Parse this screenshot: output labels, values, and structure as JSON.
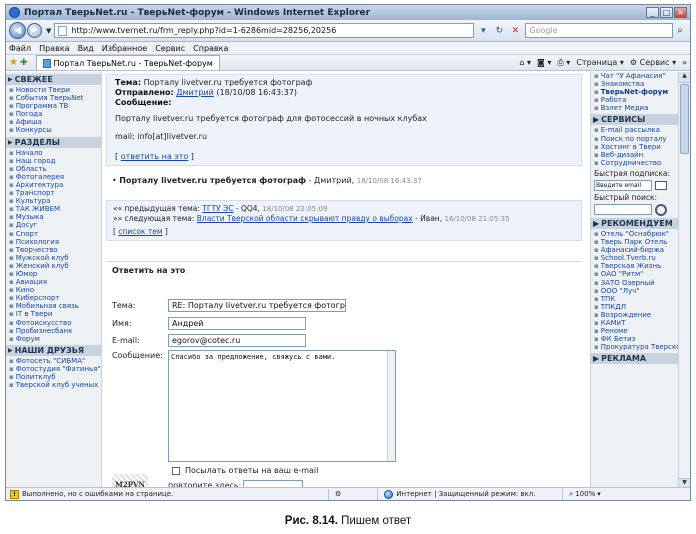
{
  "window": {
    "title": "Портал ТверьNet.ru - ТверьNet-форум - Windows Internet Explorer",
    "url": "http://www.tvernet.ru/frm_reply.php?id=1-6286mid=28256,20256",
    "search_placeholder": "Google"
  },
  "menu": [
    "Файл",
    "Правка",
    "Вид",
    "Избранное",
    "Сервис",
    "Справка"
  ],
  "tab": {
    "label": "Портал ТверьNet.ru - ТверьNet-форум"
  },
  "commands": {
    "page": "Страница",
    "tools": "Сервис"
  },
  "left": {
    "sections": [
      {
        "title": "СВЕЖЕЕ",
        "items": [
          "Новости Твери",
          "События ТверьNet",
          "Программа ТВ",
          "Погода",
          "Афиша",
          "Конкурсы"
        ]
      },
      {
        "title": "РАЗДЕЛЫ",
        "items": [
          "Начало",
          "Наш город",
          "Область",
          "Фотогалерея",
          "Архитектура",
          "Транспорт",
          "Культура",
          "ТАК ЖИВЕМ",
          "Музыка",
          "Досуг",
          "Спорт",
          "Психология",
          "Творчество",
          "Мужской клуб",
          "Женский клуб",
          "Юмор",
          "Авиация",
          "Кино",
          "Киберспорт",
          "Мобильная связь",
          "IT в Твери",
          "Фотоискусство",
          "Пробизнесбанк",
          "Форум"
        ]
      },
      {
        "title": "НАШИ ДРУЗЬЯ",
        "items": [
          "Фотосеть \"СИБМА\"",
          "Фотостудия \"Фатинья\"",
          "Политклуб",
          "Тверской клуб ученых"
        ]
      }
    ]
  },
  "post": {
    "topic_label": "Тема:",
    "topic": "Порталу livetver.ru требуется фотограф",
    "sent_label": "Отправлено:",
    "author": "Дмитрий",
    "date": "(18/10/08 16:43:37)",
    "message_label": "Сообщение:",
    "body": "Порталу livetver.ru требуется фотограф для фотосессий в ночных клубах",
    "mail": "mail: info[at]livetver.ru",
    "reply_link": "ответить на это",
    "thread_title": "Порталу livetver.ru требуется фотограф",
    "thread_author": " - Дмитрий, ",
    "thread_date": "18/10/08 16:43:37"
  },
  "nav": {
    "prev_label": "«« предыдущая тема:",
    "prev_link": "ТГТУ ЭС",
    "prev_rest": " - QQ4, ",
    "prev_date": "18/10/08 22:05:09",
    "next_label": "»» следующая тема:",
    "next_link": "Власти Тверской области скрывают правду о выборах",
    "next_rest": " - Иван, ",
    "next_date": "16/10/08 21:05:35",
    "list_link": "список тем"
  },
  "form": {
    "title": "Ответить на это",
    "subject_label": "Тема:",
    "subject_value": "RE: Порталу livetver.ru требуется фотогр",
    "name_label": "Имя:",
    "name_value": "Андрей",
    "email_label": "E-mail:",
    "email_value": "egorov@cotec.ru",
    "message_label": "Сообщение:",
    "message_value": "Спасибо за предложение, свяжусь с вами.",
    "notify_label": "Посылать ответы на ваш e-mail",
    "captcha_text": "M2PVN",
    "captcha_label": "повторите здесь:"
  },
  "right": {
    "top_items": [
      "Чат \"У Афанасия\"",
      "Знакомства",
      "ТверьNet-форум",
      "Работа",
      "Взлет Медиа"
    ],
    "services_title": "СЕРВИСЫ",
    "services": [
      "E-mail рассылка",
      "Поиск по порталу",
      "Хостинг в Твери",
      "Веб-дизайн",
      "Сотрудничество"
    ],
    "subscribe_label": "Быстрая подписка:",
    "subscribe_placeholder": "Введите email",
    "search_label": "Быстрый поиск:",
    "recommend_title": "РЕКОМЕНДУЕМ",
    "recommend": [
      "Отель \"Оснабрюк\"",
      "Тверь Парк Отель",
      "Афанасий-биржа",
      "School.Tverb.ru",
      "Тверская Жизнь",
      "ОАО \"Ритм\"",
      "ЗАТО Озерный",
      "ООО \"Луч\"",
      "ТПК",
      "ТПКДЛ",
      "Возрождение",
      "КАМиТ",
      "Реноме",
      "ФК Бетиз",
      "Прокуратура Тверской области"
    ],
    "ads_title": "РЕКЛАМА"
  },
  "status": {
    "text": "Выполнено, но с ошибками на странице.",
    "zone": "Интернет | Защищенный режим: вкл.",
    "zoom": "100%"
  },
  "caption": {
    "label": "Рис. 8.14.",
    "text": " Пишем ответ"
  }
}
